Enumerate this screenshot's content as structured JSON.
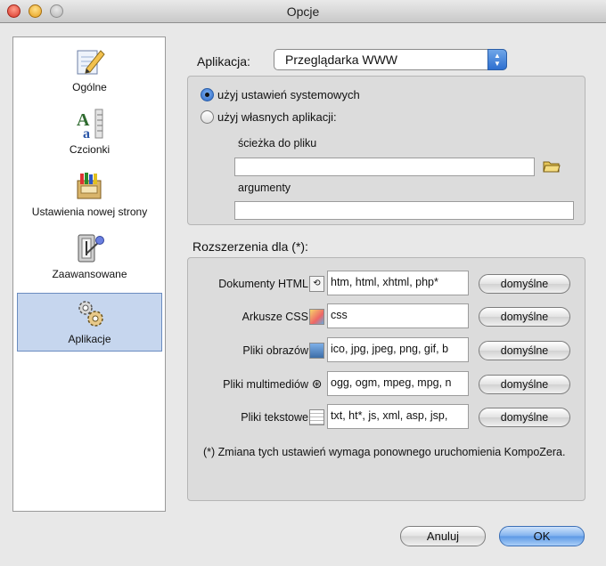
{
  "window": {
    "title": "Opcje"
  },
  "sidebar": {
    "items": [
      {
        "label": "Ogólne",
        "icon": "pencil-paper-icon",
        "selected": false
      },
      {
        "label": "Czcionki",
        "icon": "font-icon",
        "selected": false
      },
      {
        "label": "Ustawienia nowej strony",
        "icon": "crayons-icon",
        "selected": false
      },
      {
        "label": "Zaawansowane",
        "icon": "advanced-switch-icon",
        "selected": false
      },
      {
        "label": "Aplikacje",
        "icon": "gears-icon",
        "selected": true
      }
    ]
  },
  "application": {
    "label": "Aplikacja:",
    "selected": "Przeglądarka WWW"
  },
  "choice": {
    "system_label": "użyj ustawień systemowych",
    "custom_label": "użyj własnych aplikacji:",
    "selected": "system",
    "path_label": "ścieżka do pliku",
    "path_value": "",
    "args_label": "argumenty",
    "args_value": ""
  },
  "extensions": {
    "title": "Rozszerzenia dla (*):",
    "default_label": "domyślne",
    "rows": [
      {
        "label": "Dokumenty HTML",
        "icon": "html-doc-icon",
        "value": "htm, html, xhtml, php*"
      },
      {
        "label": "Arkusze CSS",
        "icon": "css-palette-icon",
        "value": "css"
      },
      {
        "label": "Pliki obrazów",
        "icon": "image-icon",
        "value": "ico, jpg, jpeg, png, gif, b"
      },
      {
        "label": "Pliki multimediów",
        "icon": "film-reel-icon",
        "value": "ogg, ogm, mpeg, mpg, n"
      },
      {
        "label": "Pliki tekstowe",
        "icon": "text-file-icon",
        "value": "txt, ht*, js, xml, asp, jsp,"
      }
    ],
    "note": "(*) Zmiana tych ustawień wymaga ponownego uruchomienia KompoZera."
  },
  "buttons": {
    "cancel": "Anuluj",
    "ok": "OK"
  },
  "colors": {
    "selection_bg": "#c6d6ee",
    "accent": "#5c98e4"
  }
}
